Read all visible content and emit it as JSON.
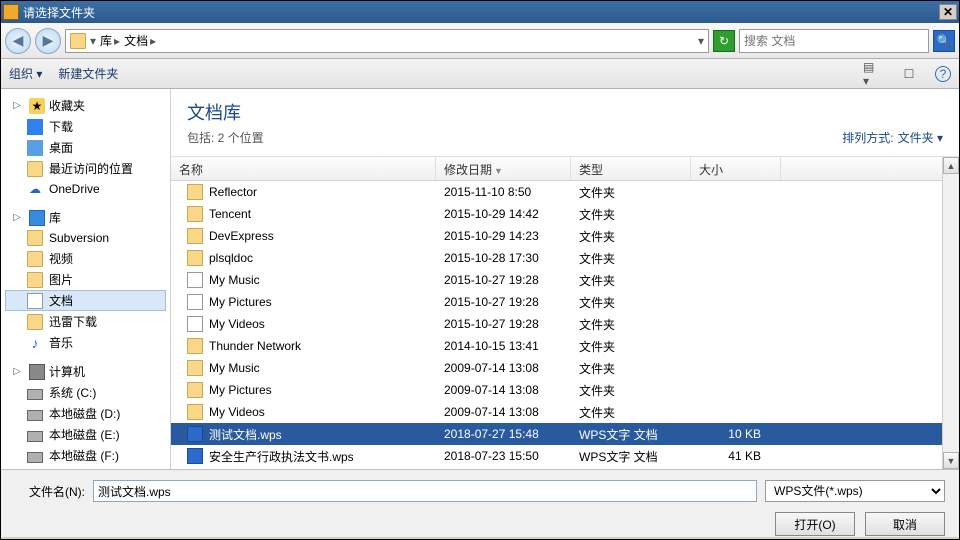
{
  "window": {
    "title": "请选择文件夹",
    "close": "✕"
  },
  "nav": {
    "back": "◀",
    "fwd": "▶",
    "segments": [
      "库",
      "文档"
    ],
    "dropdown": "▾",
    "refresh": "↻",
    "search_placeholder": "搜索 文档",
    "search_icon": "🔍"
  },
  "toolbar": {
    "organize": "组织 ▾",
    "newfolder": "新建文件夹",
    "view_icon": "▤ ▾",
    "preview_icon": "☐",
    "help_icon": "?"
  },
  "sidebar": {
    "favorites": {
      "label": "收藏夹",
      "items": [
        {
          "icon": "dl",
          "label": "下载"
        },
        {
          "icon": "desk",
          "label": "桌面"
        },
        {
          "icon": "folder",
          "label": "最近访问的位置"
        },
        {
          "icon": "cloud",
          "label": "OneDrive"
        }
      ]
    },
    "libraries": {
      "label": "库",
      "items": [
        {
          "icon": "folder",
          "label": "Subversion"
        },
        {
          "icon": "folder",
          "label": "视频"
        },
        {
          "icon": "folder",
          "label": "图片"
        },
        {
          "icon": "doc",
          "label": "文档",
          "selected": true
        },
        {
          "icon": "folder",
          "label": "迅雷下载"
        },
        {
          "icon": "music",
          "label": "音乐"
        }
      ]
    },
    "computer": {
      "label": "计算机",
      "items": [
        {
          "icon": "drive",
          "label": "系统 (C:)"
        },
        {
          "icon": "drive",
          "label": "本地磁盘 (D:)"
        },
        {
          "icon": "drive",
          "label": "本地磁盘 (E:)"
        },
        {
          "icon": "drive",
          "label": "本地磁盘 (F:)"
        }
      ]
    }
  },
  "main": {
    "title": "文档库",
    "subtitle": "包括: 2 个位置",
    "sort_label": "排列方式:",
    "sort_value": "文件夹 ▾",
    "columns": {
      "name": "名称",
      "date": "修改日期",
      "type": "类型",
      "size": "大小",
      "sort": "▼"
    },
    "rows": [
      {
        "icon": "folder",
        "name": "Reflector",
        "date": "2015-11-10 8:50",
        "type": "文件夹",
        "size": ""
      },
      {
        "icon": "folder",
        "name": "Tencent",
        "date": "2015-10-29 14:42",
        "type": "文件夹",
        "size": ""
      },
      {
        "icon": "folder",
        "name": "DevExpress",
        "date": "2015-10-29 14:23",
        "type": "文件夹",
        "size": ""
      },
      {
        "icon": "folder",
        "name": "plsqldoc",
        "date": "2015-10-28 17:30",
        "type": "文件夹",
        "size": ""
      },
      {
        "icon": "short",
        "name": "My Music",
        "date": "2015-10-27 19:28",
        "type": "文件夹",
        "size": ""
      },
      {
        "icon": "short",
        "name": "My Pictures",
        "date": "2015-10-27 19:28",
        "type": "文件夹",
        "size": ""
      },
      {
        "icon": "short",
        "name": "My Videos",
        "date": "2015-10-27 19:28",
        "type": "文件夹",
        "size": ""
      },
      {
        "icon": "folder",
        "name": "Thunder Network",
        "date": "2014-10-15 13:41",
        "type": "文件夹",
        "size": ""
      },
      {
        "icon": "folder",
        "name": "My Music",
        "date": "2009-07-14 13:08",
        "type": "文件夹",
        "size": ""
      },
      {
        "icon": "folder",
        "name": "My Pictures",
        "date": "2009-07-14 13:08",
        "type": "文件夹",
        "size": ""
      },
      {
        "icon": "folder",
        "name": "My Videos",
        "date": "2009-07-14 13:08",
        "type": "文件夹",
        "size": ""
      },
      {
        "icon": "wps",
        "name": "测试文档.wps",
        "date": "2018-07-27 15:48",
        "type": "WPS文字 文档",
        "size": "10 KB",
        "selected": true
      },
      {
        "icon": "wps",
        "name": "安全生产行政执法文书.wps",
        "date": "2018-07-23 15:50",
        "type": "WPS文字 文档",
        "size": "41 KB"
      }
    ]
  },
  "footer": {
    "filename_label": "文件名(N):",
    "filename_value": "测试文档.wps",
    "filter": "WPS文件(*.wps)",
    "open": "打开(O)",
    "cancel": "取消"
  }
}
